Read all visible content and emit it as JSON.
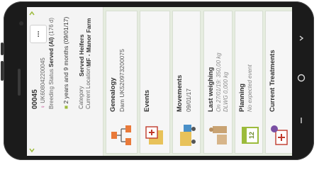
{
  "animal": {
    "id": "00045",
    "official_id": "UK608042200045",
    "breeding_status_label": "Breeding Status",
    "breeding_status_value": "Served (AI)",
    "breeding_status_days": "(176 d)",
    "age": "2 years and 9 months (09/01/17)",
    "category_label": "Category",
    "category_value": "Served Heifers",
    "location_label": "Current Location",
    "location_value": "MF - Manor Farm",
    "more_label": "..."
  },
  "tiles": {
    "genealogy": {
      "title": "Genealogy",
      "dam_label": "Dam",
      "dam_value": "UK520973200075"
    },
    "events": {
      "title": "Events"
    },
    "movements": {
      "title": "Movements",
      "date": "09/01/17"
    },
    "last_weighing": {
      "title": "Last weighing",
      "line1": "On 27/01/19: 350,00 kg",
      "line2": "DLWG 0,000 kg"
    },
    "planning": {
      "title": "Planning",
      "line1": "No expected event",
      "calendar_day": "12"
    },
    "current_treatments": {
      "title": "Current Treatments"
    }
  },
  "colors": {
    "accent": "#9cbb3c",
    "screen_bg": "#e5ecdf",
    "tile_bg": "#f6f6f6"
  },
  "icons": [
    "female-symbol-icon",
    "feeding-icon",
    "chevron-up-icon",
    "chevron-down-icon",
    "more-icon",
    "family-tree-icon",
    "events-icon",
    "truck-icon",
    "weighing-icon",
    "calendar-icon",
    "treatment-icon",
    "back-icon",
    "home-icon",
    "recent-apps-icon"
  ]
}
